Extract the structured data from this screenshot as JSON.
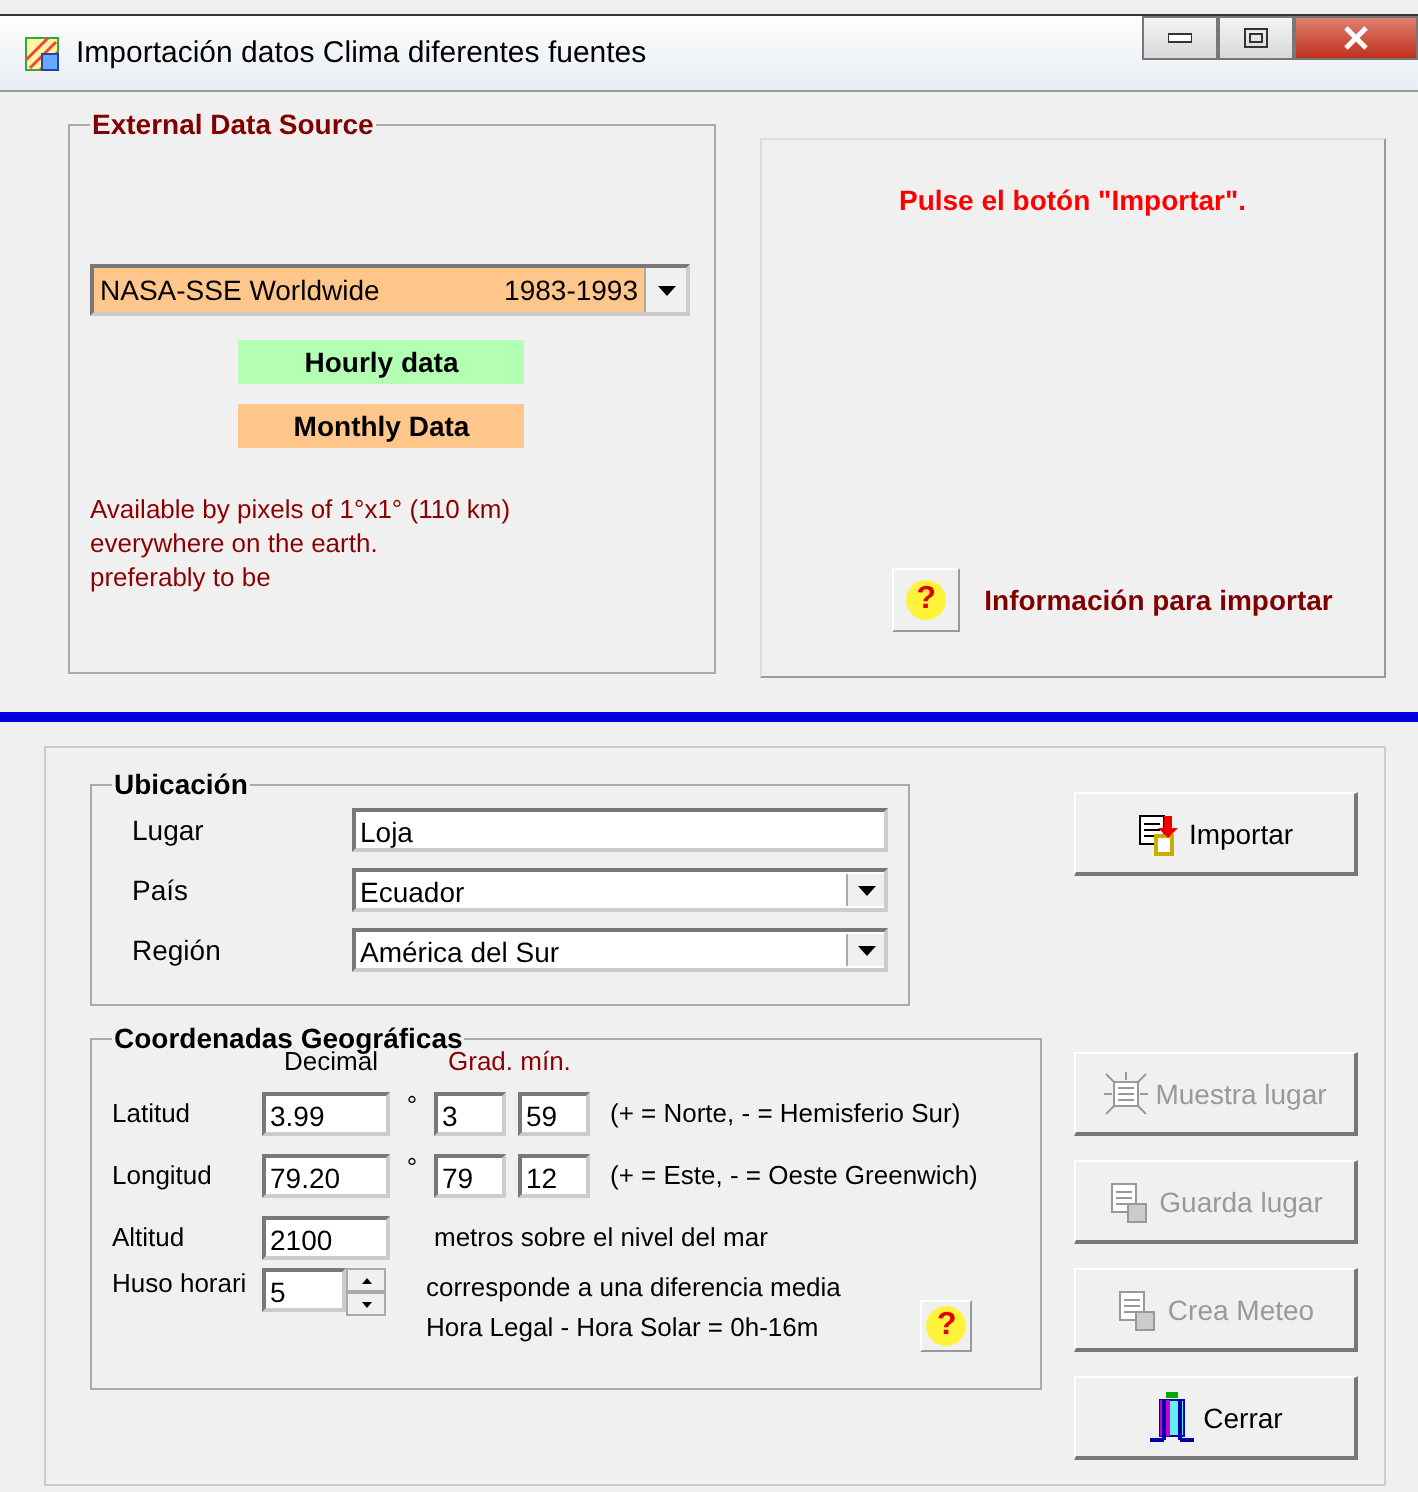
{
  "window": {
    "title": "Importación datos Clima diferentes fuentes"
  },
  "external_source": {
    "title": "External Data Source",
    "dropdown": {
      "name": "NASA-SSE  Worldwide",
      "years": "1983-1993"
    },
    "badges": [
      {
        "label": "Hourly data",
        "color": "#b3ffb3"
      },
      {
        "label": "Monthly Data",
        "color": "#ffc68c"
      }
    ],
    "description": [
      "Available by pixels of 1°x1° (110 km)",
      "everywhere on the earth.",
      "preferably to be"
    ]
  },
  "status": {
    "message": "Pulse el botón \"Importar\".",
    "help_button": "?",
    "help_label": "Información para importar"
  },
  "location": {
    "title": "Ubicación",
    "fields": [
      {
        "label": "Lugar",
        "value": "Loja",
        "kind": "text"
      },
      {
        "label": "País",
        "value": "Ecuador",
        "kind": "dropdown"
      },
      {
        "label": "Región",
        "value": "América del Sur",
        "kind": "dropdown"
      }
    ]
  },
  "coordinates": {
    "title": "Coordenadas Geográficas",
    "header_decimal": "Decimal",
    "header_grad": "Grad. mín.",
    "rows": [
      {
        "label": "Latitud",
        "decimal": "3.99",
        "unit": "°",
        "degrees": "3",
        "minutes": "59",
        "hint": "(+ = Norte, - = Hemisferio Sur)"
      },
      {
        "label": "Longitud",
        "decimal": "79.20",
        "unit": "°",
        "degrees": "79",
        "minutes": "12",
        "hint": "(+ = Este, - = Oeste Greenwich)"
      }
    ],
    "altitude": {
      "label": "Altitud",
      "value": "2100",
      "note": "metros sobre el nivel del mar"
    },
    "timezone": {
      "label": "Huso horari",
      "value": "5",
      "note": [
        "corresponde a una diferencia media",
        "Hora Legal - Hora Solar =   0h-16m"
      ],
      "help_button": "?"
    }
  },
  "buttons": [
    {
      "label": "Importar",
      "kind": "import",
      "disabled": false
    },
    {
      "label": "Muestra lugar",
      "kind": "show",
      "disabled": true
    },
    {
      "label": "Guarda lugar",
      "kind": "save",
      "disabled": true
    },
    {
      "label": "Crea Meteo",
      "kind": "save",
      "disabled": true
    },
    {
      "label": "Cerrar",
      "kind": "exit",
      "disabled": false
    }
  ]
}
